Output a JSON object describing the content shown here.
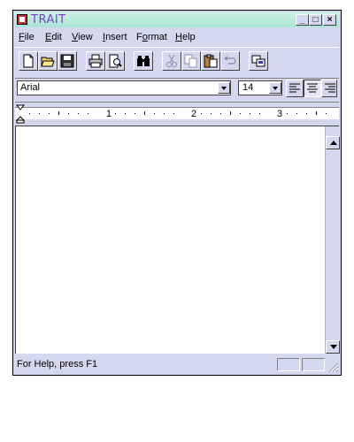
{
  "window": {
    "title": "TRAIT"
  },
  "caption_buttons": {
    "minimize": "_",
    "maximize": "□",
    "close": "×"
  },
  "menubar": {
    "items": [
      {
        "label": "File",
        "mnemonic": "F",
        "rest": "ile"
      },
      {
        "label": "Edit",
        "mnemonic": "E",
        "rest": "dit"
      },
      {
        "label": "View",
        "mnemonic": "V",
        "rest": "iew"
      },
      {
        "label": "Insert",
        "mnemonic": "I",
        "rest": "nsert"
      },
      {
        "label": "Format",
        "pre": "F",
        "mnemonic": "o",
        "rest": "rmat"
      },
      {
        "label": "Help",
        "mnemonic": "H",
        "rest": "elp"
      }
    ]
  },
  "toolbar": {
    "buttons": [
      "new",
      "open",
      "save",
      "print",
      "print-preview",
      "find",
      "cut",
      "copy",
      "paste",
      "undo",
      "insert-object"
    ]
  },
  "format": {
    "font": "Arial",
    "size": "14",
    "alignment": "center"
  },
  "ruler": {
    "numbers": [
      "1",
      "2",
      "3"
    ]
  },
  "status": {
    "text": "For Help, press F1"
  },
  "colors": {
    "chrome": "#d6d6ee",
    "title_bar": "#a9e4d4",
    "title_text": "#7a3fd0"
  }
}
